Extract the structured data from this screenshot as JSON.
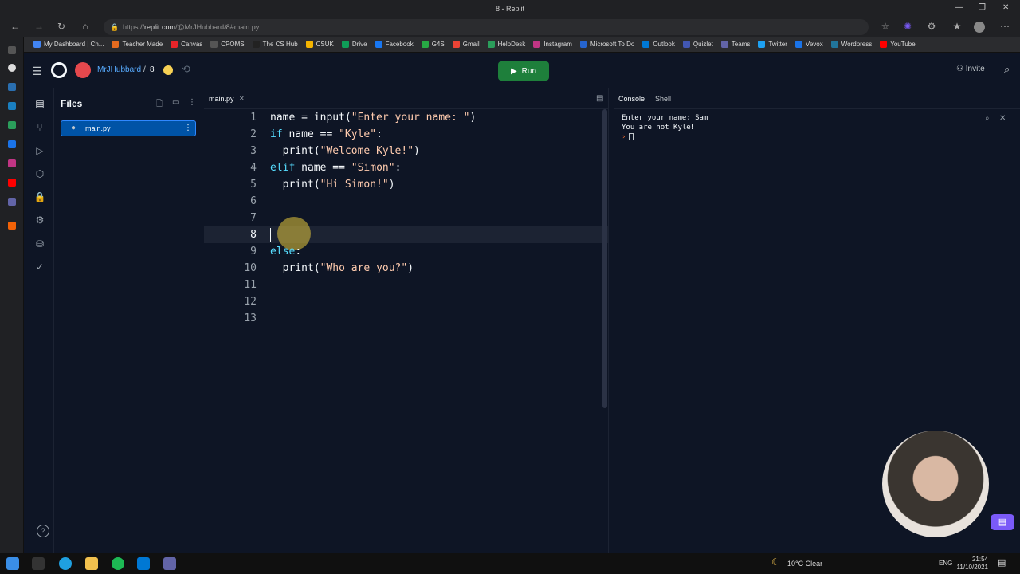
{
  "window": {
    "title": "8 - Replit"
  },
  "browser": {
    "url_prefix": "https://",
    "url_host": "replit.com",
    "url_path": "/@MrJHubbard/8#main.py"
  },
  "bookmarks": [
    {
      "label": "My Dashboard | Ch...",
      "color": "#4285f4"
    },
    {
      "label": "Teacher Made",
      "color": "#e56b1f"
    },
    {
      "label": "Canvas",
      "color": "#e72429"
    },
    {
      "label": "CPOMS",
      "color": "#555555"
    },
    {
      "label": "The CS Hub",
      "color": "#222222"
    },
    {
      "label": "CSUK",
      "color": "#f4b400"
    },
    {
      "label": "Drive",
      "color": "#0f9d58"
    },
    {
      "label": "Facebook",
      "color": "#1877f2"
    },
    {
      "label": "G4S",
      "color": "#27a844"
    },
    {
      "label": "Gmail",
      "color": "#ea4335"
    },
    {
      "label": "HelpDesk",
      "color": "#2b9e5b"
    },
    {
      "label": "Instagram",
      "color": "#c13584"
    },
    {
      "label": "Microsoft To Do",
      "color": "#2564cf"
    },
    {
      "label": "Outlook",
      "color": "#0078d4"
    },
    {
      "label": "Quizlet",
      "color": "#4257b2"
    },
    {
      "label": "Teams",
      "color": "#6264a7"
    },
    {
      "label": "Twitter",
      "color": "#1da1f2"
    },
    {
      "label": "Vevox",
      "color": "#1a73e8"
    },
    {
      "label": "Wordpress",
      "color": "#21759b"
    },
    {
      "label": "YouTube",
      "color": "#ff0000"
    }
  ],
  "header": {
    "user": "MrJHubbard",
    "separator": "/",
    "repl": "8",
    "run_label": "Run",
    "invite_label": "Invite"
  },
  "files": {
    "title": "Files",
    "items": [
      {
        "name": "main.py"
      }
    ]
  },
  "editor": {
    "tab": "main.py",
    "current_line": 8,
    "lines": [
      {
        "n": "1",
        "parts": [
          [
            "",
            "name = input("
          ],
          [
            "str",
            "\"Enter your name: \""
          ],
          [
            "",
            ")"
          ]
        ]
      },
      {
        "n": "2",
        "parts": [
          [
            "kw",
            "if"
          ],
          [
            "",
            " name == "
          ],
          [
            "str",
            "\"Kyle\""
          ],
          [
            "",
            ":"
          ]
        ]
      },
      {
        "n": "3",
        "parts": [
          [
            "",
            "  print("
          ],
          [
            "str",
            "\"Welcome Kyle!\""
          ],
          [
            "",
            ")"
          ]
        ]
      },
      {
        "n": "4",
        "parts": [
          [
            "kw",
            "elif"
          ],
          [
            "",
            " name == "
          ],
          [
            "str",
            "\"Simon\""
          ],
          [
            "",
            ":"
          ]
        ]
      },
      {
        "n": "5",
        "parts": [
          [
            "",
            "  print("
          ],
          [
            "str",
            "\"Hi Simon!\""
          ],
          [
            "",
            ")"
          ]
        ]
      },
      {
        "n": "6",
        "parts": []
      },
      {
        "n": "7",
        "parts": []
      },
      {
        "n": "8",
        "parts": []
      },
      {
        "n": "9",
        "parts": [
          [
            "kw",
            "else"
          ],
          [
            "",
            ":"
          ]
        ]
      },
      {
        "n": "10",
        "parts": [
          [
            "",
            "  print("
          ],
          [
            "str",
            "\"Who are you?\""
          ],
          [
            "",
            ")"
          ]
        ]
      },
      {
        "n": "11",
        "parts": []
      },
      {
        "n": "12",
        "parts": []
      },
      {
        "n": "13",
        "parts": []
      }
    ]
  },
  "console": {
    "tabs": [
      "Console",
      "Shell"
    ],
    "output": [
      "Enter your name: Sam",
      "You are not Kyle!"
    ],
    "prompt": "›"
  },
  "taskbar": {
    "weather": "10°C Clear",
    "lang": "ENG",
    "time": "21:54",
    "date": "11/10/2021"
  }
}
